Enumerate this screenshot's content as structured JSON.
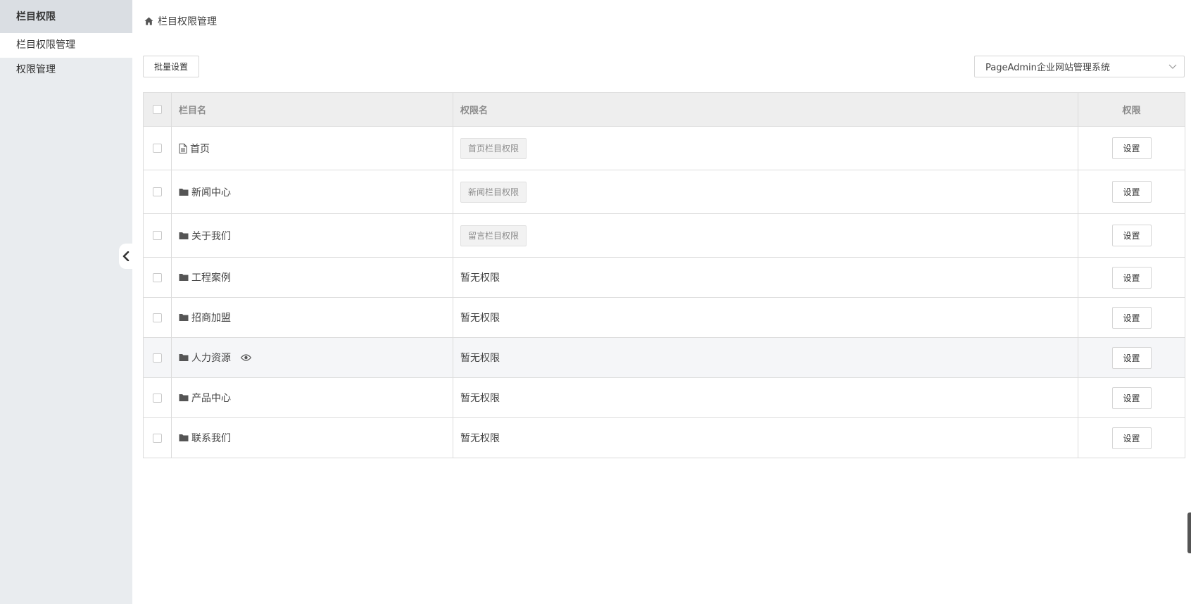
{
  "sidebar": {
    "title": "栏目权限",
    "items": [
      {
        "label": "栏目权限管理",
        "active": true
      },
      {
        "label": "权限管理",
        "active": false
      }
    ]
  },
  "breadcrumb": {
    "icon": "home-icon",
    "label": "栏目权限管理"
  },
  "toolbar": {
    "batch_label": "批量设置",
    "site_select_value": "PageAdmin企业网站管理系统"
  },
  "table": {
    "headers": {
      "name": "栏目名",
      "perm_name": "权限名",
      "perm": "权限"
    },
    "set_label": "设置",
    "rows": [
      {
        "name": "首页",
        "icon": "file-icon",
        "perm_tag": "首页栏目权限",
        "perm_text": ""
      },
      {
        "name": "新闻中心",
        "icon": "folder-icon",
        "perm_tag": "新闻栏目权限",
        "perm_text": ""
      },
      {
        "name": "关于我们",
        "icon": "folder-icon",
        "perm_tag": "留言栏目权限",
        "perm_text": ""
      },
      {
        "name": "工程案例",
        "icon": "folder-icon",
        "perm_tag": "",
        "perm_text": "暂无权限"
      },
      {
        "name": "招商加盟",
        "icon": "folder-icon",
        "perm_tag": "",
        "perm_text": "暂无权限"
      },
      {
        "name": "人力资源",
        "icon": "folder-icon",
        "perm_tag": "",
        "perm_text": "暂无权限",
        "eye": "eye-icon"
      },
      {
        "name": "产品中心",
        "icon": "folder-icon",
        "perm_tag": "",
        "perm_text": "暂无权限"
      },
      {
        "name": "联系我们",
        "icon": "folder-icon",
        "perm_tag": "",
        "perm_text": "暂无权限"
      }
    ]
  }
}
